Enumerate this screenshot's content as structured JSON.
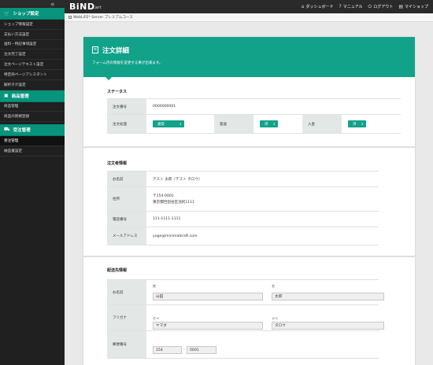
{
  "topbar": {
    "collapse_icon": "«",
    "logo": "BiND",
    "logo_sub": "Cart",
    "nav": [
      {
        "icon": "home-icon",
        "glyph": "⌂",
        "label": "ダッシュボード"
      },
      {
        "icon": "question-icon",
        "glyph": "?",
        "label": "マニュアル"
      },
      {
        "icon": "power-icon",
        "glyph": "⏻",
        "label": "ログアウト"
      },
      {
        "icon": "store-icon",
        "glyph": "▤",
        "label": "マイショップ"
      }
    ]
  },
  "sidebar": {
    "groups": [
      {
        "icon": "cart-icon",
        "glyph": "🛒",
        "title": "ショップ設定",
        "items": [
          "ショップ情報設定",
          "支払い方法設定",
          "送料・特記事項設定",
          "注文完了設定",
          "注文ページテキスト設定",
          "特定商ページアシスタント",
          "解析タグ設定"
        ]
      },
      {
        "icon": "box-icon",
        "glyph": "▣",
        "title": "商品管理",
        "items": [
          "商品管理",
          "商品の新規登録"
        ]
      },
      {
        "icon": "truck-icon",
        "glyph": "⛟",
        "title": "受注管理",
        "items": [
          "受注管理",
          "納品書設定"
        ]
      }
    ],
    "active_item": "受注管理"
  },
  "planbar": {
    "check": "✓",
    "label": "WebLiFE* Server プレミアムコース"
  },
  "banner": {
    "icon": "≡",
    "title": "注文詳細",
    "desc": "フォーム内の情報を変更する事が出来ます。"
  },
  "status": {
    "title": "ステータス",
    "order_no_label": "注文番号",
    "order_no": "0000000001",
    "order_status_label": "注文処理",
    "order_status": "通常",
    "ship_label": "発送",
    "ship": "済",
    "payment_label": "入金",
    "payment": "済"
  },
  "orderer": {
    "title": "注文者情報",
    "rows": [
      {
        "label": "お名前",
        "value": "テスト 太郎（テスト タロウ）"
      },
      {
        "label": "住所",
        "value": "〒154-0001",
        "value2": "東京都世田谷区池尻1111"
      },
      {
        "label": "電話番号",
        "value": "111-1111-1111"
      },
      {
        "label": "メールアドレス",
        "value": "yuge@minimalkraft.com"
      }
    ]
  },
  "shipping": {
    "title": "配送先情報",
    "name_label": "お名前",
    "sei_label": "姓",
    "sei": "山田",
    "mei_label": "名",
    "mei": "太郎",
    "kana_label": "フリガナ",
    "sei_kana_label": "セイ",
    "sei_kana": "ヤマダ",
    "mei_kana_label": "メイ",
    "mei_kana": "タロウ",
    "zip_label": "郵便番号",
    "zip1": "154",
    "zip_sep": "-",
    "zip2": "0001"
  },
  "colors": {
    "accent": "#12a28a",
    "sidebar_bg": "#202020",
    "topbar_bg": "#2a2a2a"
  }
}
